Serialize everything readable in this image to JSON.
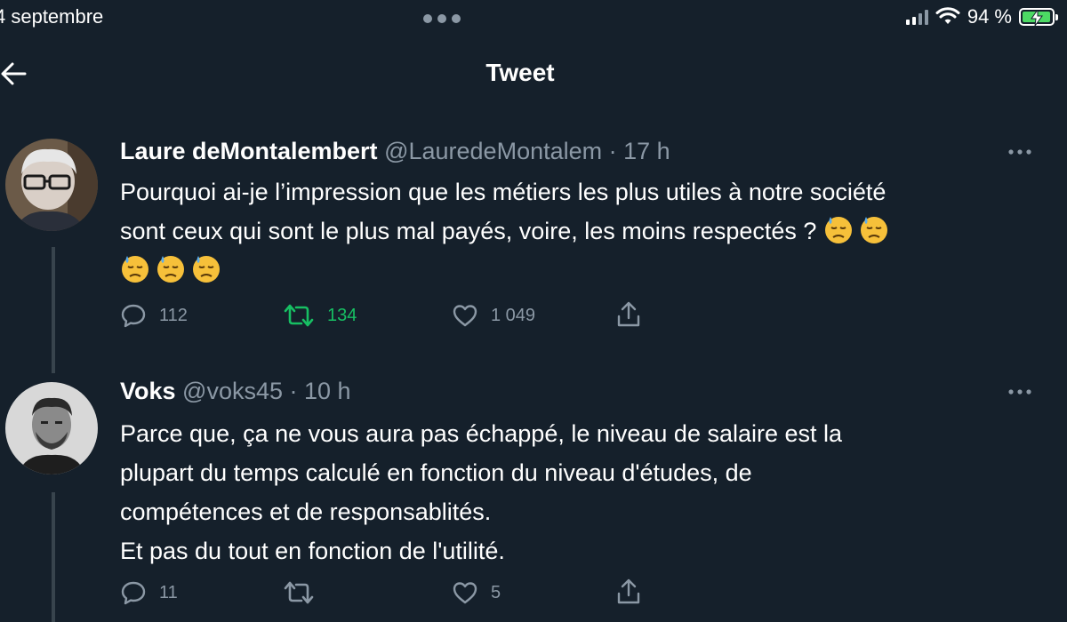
{
  "status_bar": {
    "date": "4 septembre",
    "battery_percent": "94 %",
    "battery_level": 0.94,
    "charging": true
  },
  "header": {
    "title": "Tweet"
  },
  "tweets": [
    {
      "author_name": "Laure deMontalembert",
      "author_handle": "@LauredeMontalem",
      "time": "17 h",
      "text_line1": "Pourquoi ai-je l’impression que les métiers les plus utiles à notre société",
      "text_line2": "sont ceux qui sont le plus mal payés, voire, les moins respectés ?",
      "emoji": "downcast-face-with-sweat-emoji",
      "actions": {
        "replies": "112",
        "retweets": "134",
        "likes": "1 049",
        "retweeted": true
      }
    },
    {
      "author_name": "Voks",
      "author_handle": "@voks45",
      "time": "10 h",
      "text_lines": [
        "Parce que, ça ne vous aura pas échappé, le niveau de salaire est la",
        "plupart du temps calculé en fonction du niveau d'études, de",
        "compétences et de responsablités.",
        "Et pas du tout en fonction de l'utilité."
      ],
      "actions": {
        "replies": "11",
        "retweets": "",
        "likes": "5",
        "retweeted": false
      }
    }
  ],
  "colors": {
    "background": "#15202b",
    "text": "#ffffff",
    "secondary_text": "#8b98a5",
    "retweet_green": "#17bf63",
    "thread_line": "#38444d"
  }
}
